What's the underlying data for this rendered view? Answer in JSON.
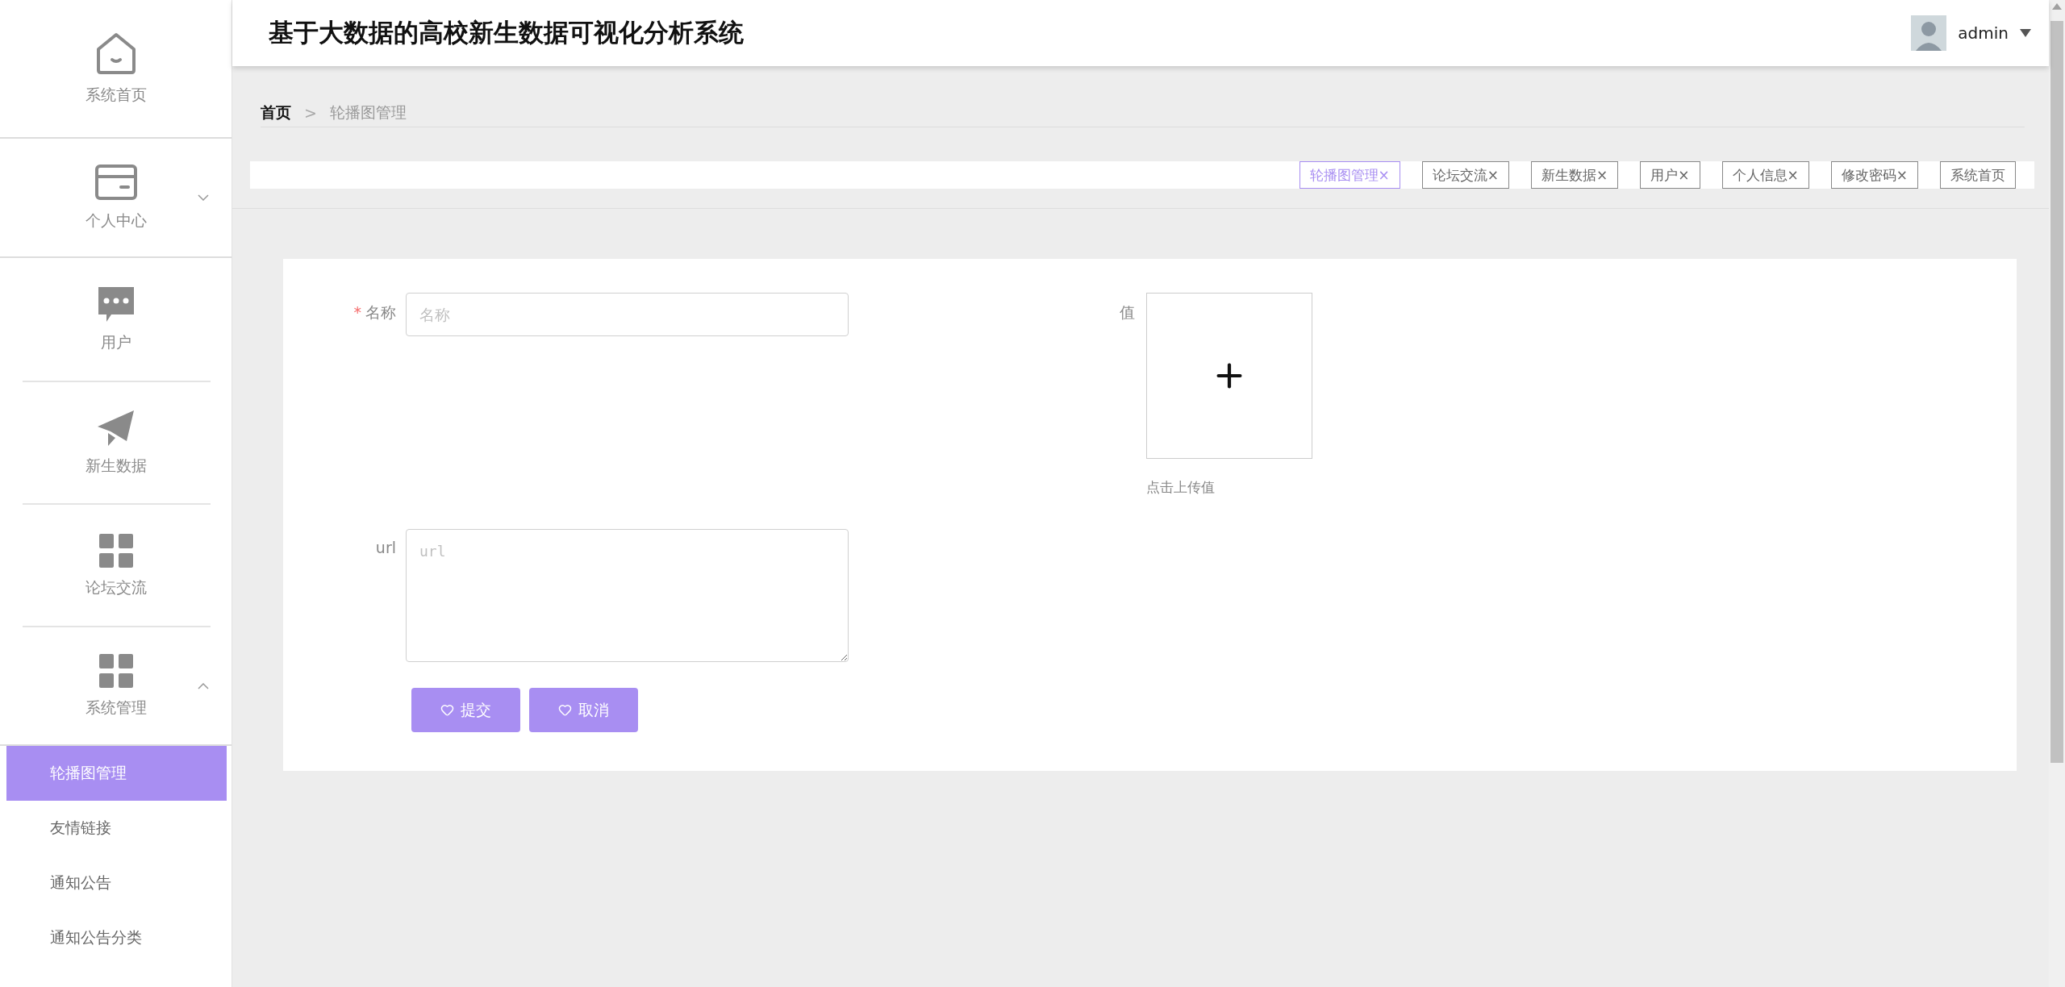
{
  "header": {
    "title": "基于大数据的高校新生数据可视化分析系统",
    "user": {
      "name": "admin"
    }
  },
  "sidebar": {
    "items": [
      {
        "kind": "link",
        "label": "系统首页"
      },
      {
        "kind": "group",
        "label": "个人中心",
        "expanded": false
      },
      {
        "kind": "link",
        "label": "用户"
      },
      {
        "kind": "link",
        "label": "新生数据"
      },
      {
        "kind": "link",
        "label": "论坛交流"
      },
      {
        "kind": "group",
        "label": "系统管理",
        "expanded": true,
        "children": [
          {
            "label": "轮播图管理",
            "selected": true
          },
          {
            "label": "友情链接",
            "selected": false
          },
          {
            "label": "通知公告",
            "selected": false
          },
          {
            "label": "通知公告分类",
            "selected": false
          }
        ]
      }
    ]
  },
  "breadcrumb": {
    "separator": ">",
    "items": [
      "首页",
      "轮播图管理"
    ]
  },
  "tab_bar": {
    "close_glyph": "×",
    "tabs": [
      {
        "label": "轮播图管理",
        "selected": true,
        "closable": true
      },
      {
        "label": "论坛交流",
        "selected": false,
        "closable": true
      },
      {
        "label": "新生数据",
        "selected": false,
        "closable": true
      },
      {
        "label": "用户",
        "selected": false,
        "closable": true
      },
      {
        "label": "个人信息",
        "selected": false,
        "closable": true
      },
      {
        "label": "修改密码",
        "selected": false,
        "closable": true
      },
      {
        "label": "系统首页",
        "selected": false,
        "closable": false
      }
    ]
  },
  "form": {
    "required_mark": "*",
    "fields": [
      {
        "kind": "input",
        "label": "名称",
        "required": true,
        "placeholder": "名称"
      },
      {
        "kind": "upload",
        "label": "值",
        "required": false,
        "hint": "点击上传值"
      },
      {
        "kind": "textarea",
        "label": "url",
        "required": false,
        "placeholder": "url"
      }
    ],
    "buttons": [
      "提交",
      "取消"
    ]
  }
}
